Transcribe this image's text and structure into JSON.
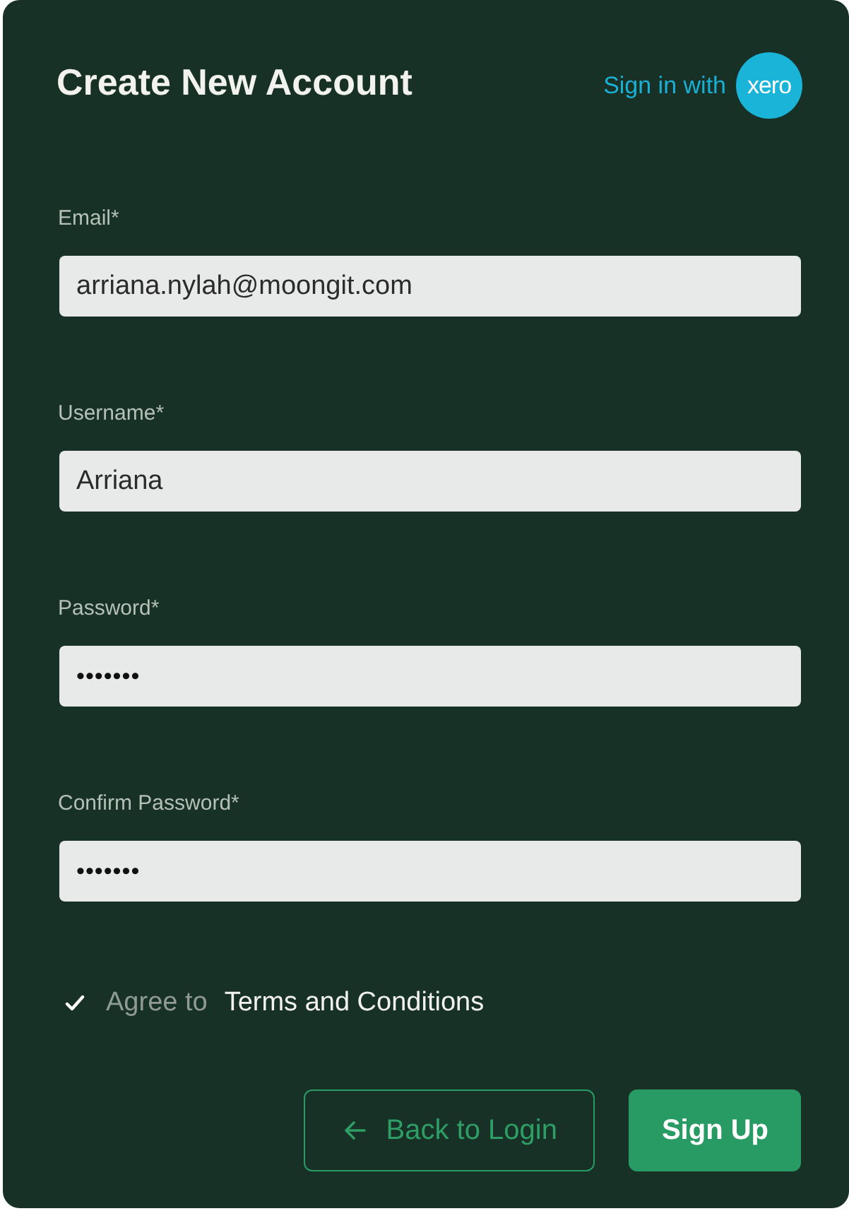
{
  "title": "Create New Account",
  "sign_in": {
    "label": "Sign in with",
    "logo_text": "xero"
  },
  "fields": [
    {
      "label": "Email*",
      "value": "arriana.nylah@moongit.com",
      "kind": "text"
    },
    {
      "label": "Username*",
      "value": "Arriana",
      "kind": "text"
    },
    {
      "label": "Password*",
      "value": "•••••••",
      "kind": "password"
    },
    {
      "label": "Confirm Password*",
      "value": "•••••••",
      "kind": "password"
    }
  ],
  "agree": {
    "checked": true,
    "label": "Agree to",
    "link": "Terms and Conditions"
  },
  "buttons": [
    {
      "label": "Back to Login",
      "kind": "secondary"
    },
    {
      "label": "Sign Up",
      "kind": "primary"
    }
  ]
}
